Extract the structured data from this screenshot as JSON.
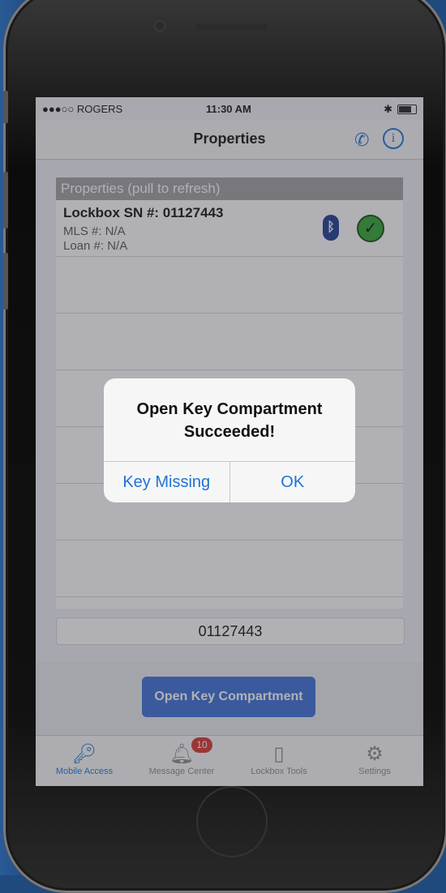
{
  "status": {
    "carrier": "●●●○○ ROGERS",
    "time": "11:30 AM"
  },
  "navbar": {
    "title": "Properties",
    "phone_icon": "phone-icon",
    "info_icon": "info-icon"
  },
  "list": {
    "header": "Properties (pull to refresh)",
    "items": [
      {
        "title": "Lockbox SN #: 01127443",
        "mls": "MLS #: N/A",
        "loan": "Loan #: N/A"
      }
    ]
  },
  "serial_field": {
    "value": "01127443"
  },
  "action_button": {
    "label": "Open Key Compartment"
  },
  "tabs": [
    {
      "label": "Mobile Access",
      "icon": "key-icon",
      "active": true
    },
    {
      "label": "Message Center",
      "icon": "bell-icon",
      "badge": "10"
    },
    {
      "label": "Lockbox Tools",
      "icon": "lockbox-icon"
    },
    {
      "label": "Settings",
      "icon": "gear-icon"
    }
  ],
  "alert": {
    "title": "Open Key Compartment Succeeded!",
    "buttons": [
      "Key Missing",
      "OK"
    ]
  },
  "colors": {
    "accent": "#1e73d6",
    "button": "#3a6fd8",
    "badge": "#d9322b",
    "success": "#2ea52e"
  }
}
